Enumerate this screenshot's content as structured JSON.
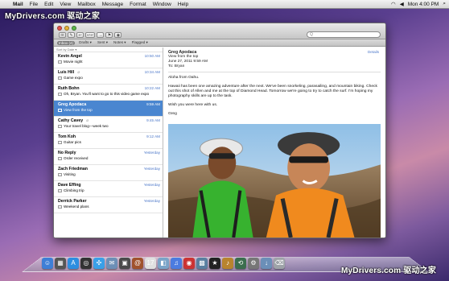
{
  "menubar": {
    "apple": "",
    "app": "Mail",
    "items": [
      "File",
      "Edit",
      "View",
      "Mailbox",
      "Message",
      "Format",
      "Window",
      "Help"
    ],
    "clock": "Mon 4:00 PM"
  },
  "watermark": "MyDrivers.com 驱动之家",
  "window": {
    "toolbar": {
      "buttons": [
        "✉",
        "✎",
        "↩",
        "↩↩",
        "→",
        "⚑",
        "◉"
      ],
      "search_placeholder": "Q"
    },
    "favorites": [
      {
        "label": "Inbox (4)",
        "active": true
      },
      {
        "label": "Drafts ▾",
        "active": false
      },
      {
        "label": "Sent ▾",
        "active": false
      },
      {
        "label": "Notes ▾",
        "active": false
      },
      {
        "label": "Flagged ▾",
        "active": false
      }
    ],
    "sort_label": "Sort by Date ▾",
    "messages": [
      {
        "from": "Kevin Angel",
        "time": "10:50 AM",
        "subject": "Movie night",
        "selected": false,
        "attachment": false
      },
      {
        "from": "Luis Hill",
        "time": "10:34 AM",
        "subject": "Game expo",
        "selected": false,
        "attachment": true
      },
      {
        "from": "Ruth Bohn",
        "time": "10:22 AM",
        "subject": "Oh, Bryan. You'll want to go to this video game expo",
        "selected": false,
        "attachment": false
      },
      {
        "from": "Greg Apodaca",
        "time": "9:59 AM",
        "subject": "View from the top",
        "selected": true,
        "attachment": false
      },
      {
        "from": "Cathy Cavey",
        "time": "9:45 AM",
        "subject": "Your travel blog—week two",
        "selected": false,
        "attachment": true
      },
      {
        "from": "Bryan, I had to tell you that this restaurant is",
        "time": "",
        "subject": "...",
        "selected": false,
        "attachment": false
      },
      {
        "from": "Tom Koh",
        "time": "9:12 AM",
        "subject": "Guitar pics",
        "selected": false,
        "attachment": false
      },
      {
        "from": "No Reply",
        "time": "Yesterday",
        "subject": "Order received",
        "selected": false,
        "attachment": false
      },
      {
        "from": "Zach Friedman",
        "time": "Yesterday",
        "subject": "Visiting",
        "selected": false,
        "attachment": false
      },
      {
        "from": "Dave Effing",
        "time": "Yesterday",
        "subject": "Climbing trip",
        "selected": false,
        "attachment": false
      },
      {
        "from": "Derrick Parker",
        "time": "Yesterday",
        "subject": "Weekend plans",
        "selected": false,
        "attachment": false
      }
    ],
    "reader": {
      "from": "Greg Apodaca",
      "subject": "View from the top",
      "date": "June 27, 2011 9:59 AM",
      "to": "To: Bryan",
      "details": "Details",
      "greeting": "Aloha from Oahu.",
      "paragraph": "Hawaii has been one amazing adventure after the next. We've been snorkeling, parasailing, and mountain biking. Check out this shot of Allen and me at the top of Diamond Head. Tomorrow we're going to try to catch the surf. I'm hoping my photography skills are up to the task.",
      "wish": "Wish you were here with us.",
      "signoff": "Greg"
    }
  },
  "dock": {
    "icons": [
      {
        "name": "finder-icon",
        "color": "#3e7fd6",
        "glyph": "☺"
      },
      {
        "name": "launchpad-icon",
        "color": "#555",
        "glyph": "▦"
      },
      {
        "name": "appstore-icon",
        "color": "#2d8ee0",
        "glyph": "A"
      },
      {
        "name": "mission-control-icon",
        "color": "#333",
        "glyph": "◎"
      },
      {
        "name": "safari-icon",
        "color": "#3aa0e8",
        "glyph": "✣"
      },
      {
        "name": "mail-icon",
        "color": "#6d8fb6",
        "glyph": "✉"
      },
      {
        "name": "facetime-icon",
        "color": "#4a4a4a",
        "glyph": "▣"
      },
      {
        "name": "addressbook-icon",
        "color": "#a0522d",
        "glyph": "@"
      },
      {
        "name": "ical-icon",
        "color": "#e0e0e0",
        "glyph": "17"
      },
      {
        "name": "preview-icon",
        "color": "#7aa4c8",
        "glyph": "◧"
      },
      {
        "name": "itunes-icon",
        "color": "#4c7ce0",
        "glyph": "♫"
      },
      {
        "name": "photobooth-icon",
        "color": "#c33",
        "glyph": "◉"
      },
      {
        "name": "iphoto-icon",
        "color": "#5a7fa0",
        "glyph": "▩"
      },
      {
        "name": "imovie-icon",
        "color": "#222",
        "glyph": "★"
      },
      {
        "name": "garageband-icon",
        "color": "#b8842e",
        "glyph": "♪"
      },
      {
        "name": "timemachine-icon",
        "color": "#3b6e4e",
        "glyph": "⟲"
      },
      {
        "name": "system-preferences-icon",
        "color": "#777",
        "glyph": "⚙"
      },
      {
        "name": "downloads-icon",
        "color": "#6b8fb8",
        "glyph": "↓"
      },
      {
        "name": "trash-icon",
        "color": "#9ea3a8",
        "glyph": "⌫"
      }
    ]
  }
}
